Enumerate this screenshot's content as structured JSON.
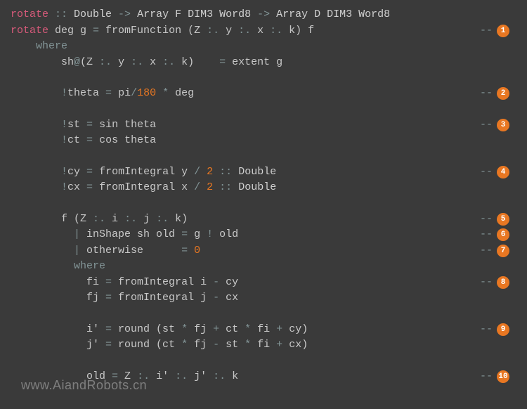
{
  "lines": [
    {
      "tokens": [
        {
          "cls": "fn",
          "t": "rotate"
        },
        {
          "cls": "op",
          "t": " :: "
        },
        {
          "cls": "ty",
          "t": "Double"
        },
        {
          "cls": "op",
          "t": " -> "
        },
        {
          "cls": "ty",
          "t": "Array F DIM3 Word8"
        },
        {
          "cls": "op",
          "t": " -> "
        },
        {
          "cls": "ty",
          "t": "Array D DIM3 Word8"
        }
      ]
    },
    {
      "tokens": [
        {
          "cls": "fn",
          "t": "rotate"
        },
        {
          "cls": "txt",
          "t": " deg g "
        },
        {
          "cls": "op",
          "t": "="
        },
        {
          "cls": "txt",
          "t": " fromFunction (Z "
        },
        {
          "cls": "op",
          "t": ":."
        },
        {
          "cls": "txt",
          "t": " y "
        },
        {
          "cls": "op",
          "t": ":."
        },
        {
          "cls": "txt",
          "t": " x "
        },
        {
          "cls": "op",
          "t": ":."
        },
        {
          "cls": "txt",
          "t": " k) f"
        }
      ],
      "badge": "1"
    },
    {
      "tokens": [
        {
          "cls": "txt",
          "t": "    "
        },
        {
          "cls": "kw",
          "t": "where"
        }
      ]
    },
    {
      "tokens": [
        {
          "cls": "txt",
          "t": "        sh"
        },
        {
          "cls": "op",
          "t": "@"
        },
        {
          "cls": "txt",
          "t": "(Z "
        },
        {
          "cls": "op",
          "t": ":."
        },
        {
          "cls": "txt",
          "t": " y "
        },
        {
          "cls": "op",
          "t": ":."
        },
        {
          "cls": "txt",
          "t": " x "
        },
        {
          "cls": "op",
          "t": ":."
        },
        {
          "cls": "txt",
          "t": " k)    "
        },
        {
          "cls": "op",
          "t": "="
        },
        {
          "cls": "txt",
          "t": " extent g"
        }
      ]
    },
    {
      "tokens": [
        {
          "cls": "txt",
          "t": ""
        }
      ]
    },
    {
      "tokens": [
        {
          "cls": "txt",
          "t": "        "
        },
        {
          "cls": "op",
          "t": "!"
        },
        {
          "cls": "txt",
          "t": "theta "
        },
        {
          "cls": "op",
          "t": "="
        },
        {
          "cls": "txt",
          "t": " pi"
        },
        {
          "cls": "op",
          "t": "/"
        },
        {
          "cls": "num",
          "t": "180"
        },
        {
          "cls": "txt",
          "t": " "
        },
        {
          "cls": "op",
          "t": "*"
        },
        {
          "cls": "txt",
          "t": " deg"
        }
      ],
      "badge": "2"
    },
    {
      "tokens": [
        {
          "cls": "txt",
          "t": ""
        }
      ]
    },
    {
      "tokens": [
        {
          "cls": "txt",
          "t": "        "
        },
        {
          "cls": "op",
          "t": "!"
        },
        {
          "cls": "txt",
          "t": "st "
        },
        {
          "cls": "op",
          "t": "="
        },
        {
          "cls": "txt",
          "t": " sin theta"
        }
      ],
      "badge": "3"
    },
    {
      "tokens": [
        {
          "cls": "txt",
          "t": "        "
        },
        {
          "cls": "op",
          "t": "!"
        },
        {
          "cls": "txt",
          "t": "ct "
        },
        {
          "cls": "op",
          "t": "="
        },
        {
          "cls": "txt",
          "t": " cos theta"
        }
      ]
    },
    {
      "tokens": [
        {
          "cls": "txt",
          "t": ""
        }
      ]
    },
    {
      "tokens": [
        {
          "cls": "txt",
          "t": "        "
        },
        {
          "cls": "op",
          "t": "!"
        },
        {
          "cls": "txt",
          "t": "cy "
        },
        {
          "cls": "op",
          "t": "="
        },
        {
          "cls": "txt",
          "t": " fromIntegral y "
        },
        {
          "cls": "op",
          "t": "/"
        },
        {
          "cls": "txt",
          "t": " "
        },
        {
          "cls": "num",
          "t": "2"
        },
        {
          "cls": "txt",
          "t": " "
        },
        {
          "cls": "op",
          "t": "::"
        },
        {
          "cls": "txt",
          "t": " "
        },
        {
          "cls": "ty",
          "t": "Double"
        }
      ],
      "badge": "4"
    },
    {
      "tokens": [
        {
          "cls": "txt",
          "t": "        "
        },
        {
          "cls": "op",
          "t": "!"
        },
        {
          "cls": "txt",
          "t": "cx "
        },
        {
          "cls": "op",
          "t": "="
        },
        {
          "cls": "txt",
          "t": " fromIntegral x "
        },
        {
          "cls": "op",
          "t": "/"
        },
        {
          "cls": "txt",
          "t": " "
        },
        {
          "cls": "num",
          "t": "2"
        },
        {
          "cls": "txt",
          "t": " "
        },
        {
          "cls": "op",
          "t": "::"
        },
        {
          "cls": "txt",
          "t": " "
        },
        {
          "cls": "ty",
          "t": "Double"
        }
      ]
    },
    {
      "tokens": [
        {
          "cls": "txt",
          "t": ""
        }
      ]
    },
    {
      "tokens": [
        {
          "cls": "txt",
          "t": "        f (Z "
        },
        {
          "cls": "op",
          "t": ":."
        },
        {
          "cls": "txt",
          "t": " i "
        },
        {
          "cls": "op",
          "t": ":."
        },
        {
          "cls": "txt",
          "t": " j "
        },
        {
          "cls": "op",
          "t": ":."
        },
        {
          "cls": "txt",
          "t": " k)"
        }
      ],
      "badge": "5"
    },
    {
      "tokens": [
        {
          "cls": "txt",
          "t": "          "
        },
        {
          "cls": "op",
          "t": "|"
        },
        {
          "cls": "txt",
          "t": " inShape sh old "
        },
        {
          "cls": "op",
          "t": "="
        },
        {
          "cls": "txt",
          "t": " g "
        },
        {
          "cls": "op",
          "t": "!"
        },
        {
          "cls": "txt",
          "t": " old"
        }
      ],
      "badge": "6"
    },
    {
      "tokens": [
        {
          "cls": "txt",
          "t": "          "
        },
        {
          "cls": "op",
          "t": "|"
        },
        {
          "cls": "txt",
          "t": " otherwise      "
        },
        {
          "cls": "op",
          "t": "="
        },
        {
          "cls": "txt",
          "t": " "
        },
        {
          "cls": "num",
          "t": "0"
        }
      ],
      "badge": "7"
    },
    {
      "tokens": [
        {
          "cls": "txt",
          "t": "          "
        },
        {
          "cls": "kw",
          "t": "where"
        }
      ]
    },
    {
      "tokens": [
        {
          "cls": "txt",
          "t": "            fi "
        },
        {
          "cls": "op",
          "t": "="
        },
        {
          "cls": "txt",
          "t": " fromIntegral i "
        },
        {
          "cls": "op",
          "t": "-"
        },
        {
          "cls": "txt",
          "t": " cy"
        }
      ],
      "badge": "8"
    },
    {
      "tokens": [
        {
          "cls": "txt",
          "t": "            fj "
        },
        {
          "cls": "op",
          "t": "="
        },
        {
          "cls": "txt",
          "t": " fromIntegral j "
        },
        {
          "cls": "op",
          "t": "-"
        },
        {
          "cls": "txt",
          "t": " cx"
        }
      ]
    },
    {
      "tokens": [
        {
          "cls": "txt",
          "t": ""
        }
      ]
    },
    {
      "tokens": [
        {
          "cls": "txt",
          "t": "            i' "
        },
        {
          "cls": "op",
          "t": "="
        },
        {
          "cls": "txt",
          "t": " round (st "
        },
        {
          "cls": "op",
          "t": "*"
        },
        {
          "cls": "txt",
          "t": " fj "
        },
        {
          "cls": "op",
          "t": "+"
        },
        {
          "cls": "txt",
          "t": " ct "
        },
        {
          "cls": "op",
          "t": "*"
        },
        {
          "cls": "txt",
          "t": " fi "
        },
        {
          "cls": "op",
          "t": "+"
        },
        {
          "cls": "txt",
          "t": " cy)"
        }
      ],
      "badge": "9"
    },
    {
      "tokens": [
        {
          "cls": "txt",
          "t": "            j' "
        },
        {
          "cls": "op",
          "t": "="
        },
        {
          "cls": "txt",
          "t": " round (ct "
        },
        {
          "cls": "op",
          "t": "*"
        },
        {
          "cls": "txt",
          "t": " fj "
        },
        {
          "cls": "op",
          "t": "-"
        },
        {
          "cls": "txt",
          "t": " st "
        },
        {
          "cls": "op",
          "t": "*"
        },
        {
          "cls": "txt",
          "t": " fi "
        },
        {
          "cls": "op",
          "t": "+"
        },
        {
          "cls": "txt",
          "t": " cx)"
        }
      ]
    },
    {
      "tokens": [
        {
          "cls": "txt",
          "t": ""
        }
      ]
    },
    {
      "tokens": [
        {
          "cls": "txt",
          "t": "            old "
        },
        {
          "cls": "op",
          "t": "="
        },
        {
          "cls": "txt",
          "t": " Z "
        },
        {
          "cls": "op",
          "t": ":."
        },
        {
          "cls": "txt",
          "t": " i' "
        },
        {
          "cls": "op",
          "t": ":."
        },
        {
          "cls": "txt",
          "t": " j' "
        },
        {
          "cls": "op",
          "t": ":."
        },
        {
          "cls": "txt",
          "t": " k"
        }
      ],
      "badge": "10"
    }
  ],
  "dashes": "--",
  "watermark": "www.AiandRobots.cn"
}
